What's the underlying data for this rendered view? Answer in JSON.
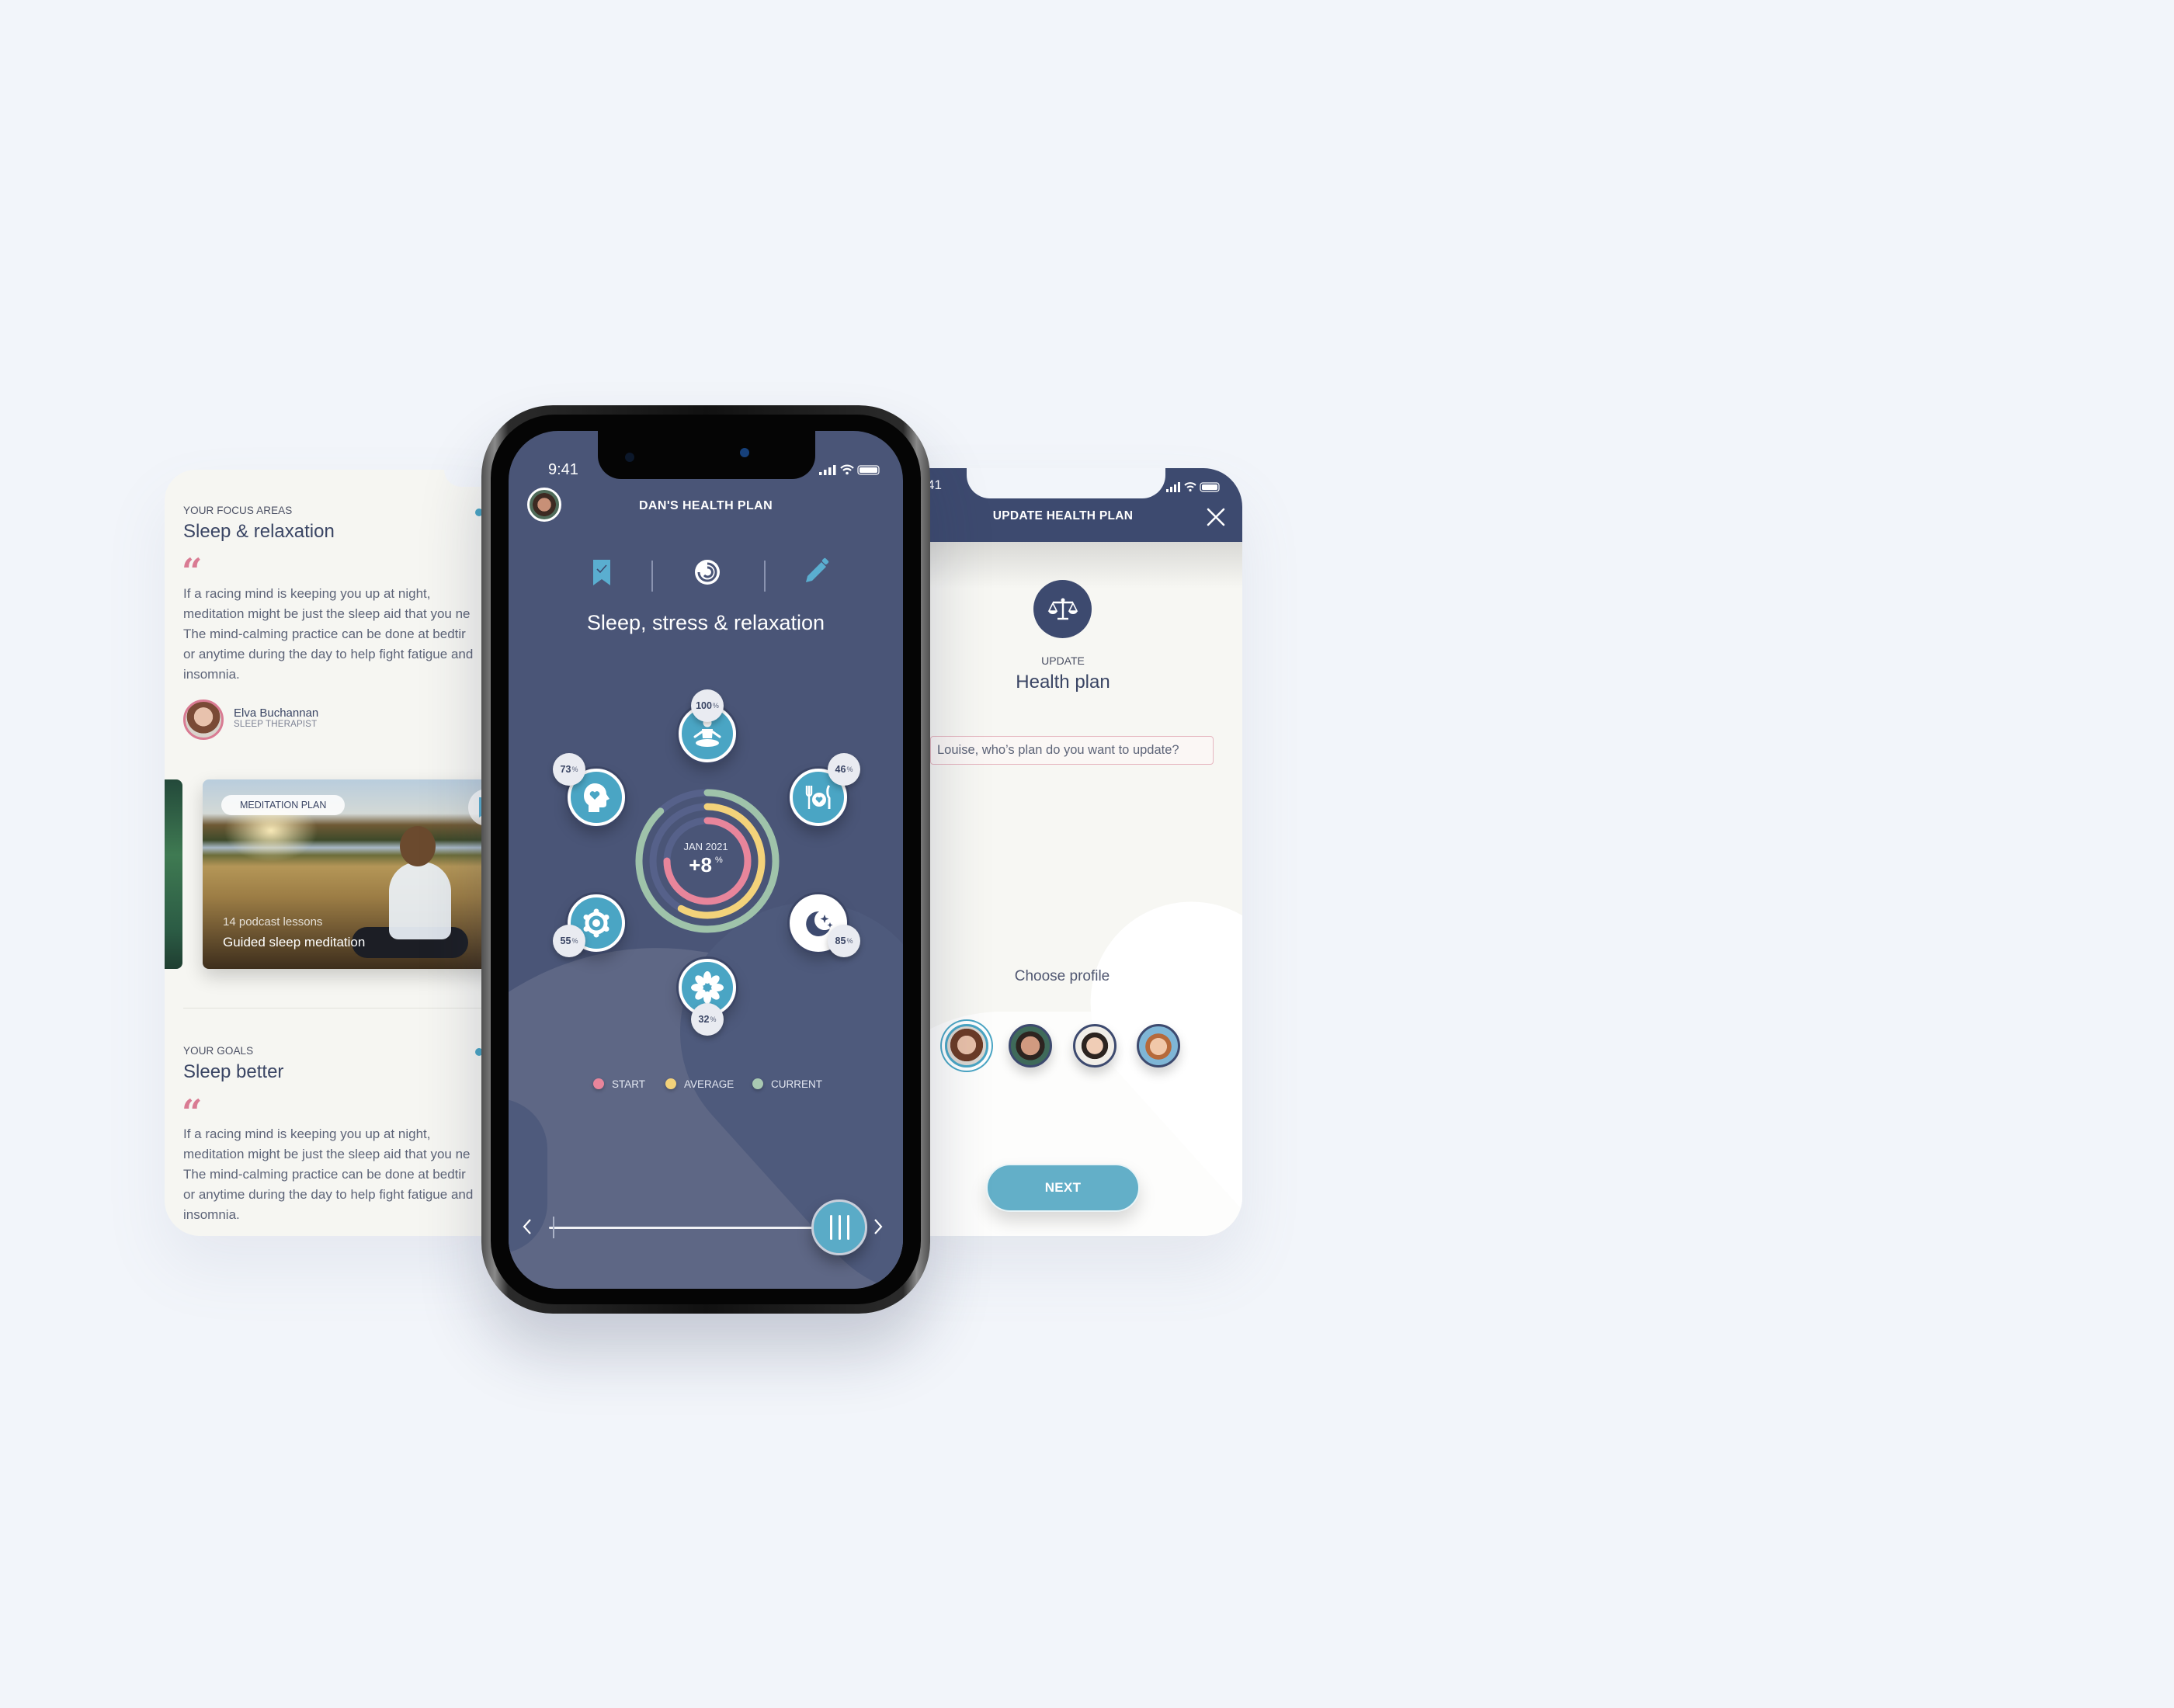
{
  "left_screen": {
    "focus": {
      "eyebrow": "YOUR FOCUS AREAS",
      "title": "Sleep & relaxation",
      "quote_mark": "“",
      "paragraph_lines": [
        "If a racing mind is keeping you up at night,",
        "meditation might be just the sleep aid that you ne",
        "The mind-calming practice can be done at bedtir",
        "or anytime during the day to help fight fatigue and",
        "insomnia."
      ],
      "therapist": {
        "name": "Elva Buchannan",
        "role": "SLEEP THERAPIST"
      }
    },
    "meditation_card": {
      "tag": "MEDITATION PLAN",
      "subtitle": "14 podcast lessons",
      "title": "Guided sleep meditation",
      "bookmark_icon": "bookmark-star-icon"
    },
    "goals": {
      "eyebrow": "YOUR GOALS",
      "title": "Sleep better",
      "quote_mark": "“",
      "paragraph_lines": [
        "If a racing mind is keeping you up at night,",
        "meditation might be just the sleep aid that you ne",
        "The mind-calming practice can be done at bedtir",
        "or anytime during the day to help fight fatigue and",
        "insomnia."
      ]
    }
  },
  "center_screen": {
    "status_time": "9:41",
    "title": "DAN'S HEALTH PLAN",
    "toolbar": [
      "bookmark-check-icon",
      "progress-spiral-icon",
      "pencil-icon"
    ],
    "heading": "Sleep, stress & relaxation",
    "ring": {
      "date": "JAN 2021",
      "value": "+8",
      "unit": "%"
    },
    "nodes": [
      {
        "icon": "meditation-icon",
        "value": "100",
        "unit": "%"
      },
      {
        "icon": "nutrition-icon",
        "value": "46",
        "unit": "%"
      },
      {
        "icon": "sleep-moon-icon",
        "value": "85",
        "unit": "%"
      },
      {
        "icon": "flower-icon",
        "value": "32",
        "unit": "%"
      },
      {
        "icon": "gear-flower-icon",
        "value": "55",
        "unit": "%"
      },
      {
        "icon": "mind-heart-icon",
        "value": "73",
        "unit": "%"
      }
    ],
    "legend": [
      {
        "label": "START",
        "color": "#e8859b"
      },
      {
        "label": "AVERAGE",
        "color": "#f3d27a"
      },
      {
        "label": "CURRENT",
        "color": "#a9c9b2"
      }
    ],
    "slider": {
      "position_fraction": 1.0,
      "prev_icon": "chevron-left-icon",
      "next_icon": "chevron-right-icon"
    }
  },
  "chart_data": {
    "type": "radial-bar",
    "title": "Sleep, stress & relaxation",
    "center_label": "JAN 2021",
    "center_value": "+8 %",
    "series": [
      {
        "name": "START",
        "fraction": 0.75,
        "color": "#e8859b"
      },
      {
        "name": "AVERAGE",
        "fraction": 0.58,
        "color": "#f3d27a"
      },
      {
        "name": "CURRENT",
        "fraction": 0.88,
        "color": "#9fc3aa"
      }
    ],
    "categories": [
      {
        "name": "meditation",
        "value": 100
      },
      {
        "name": "nutrition",
        "value": 46
      },
      {
        "name": "sleep",
        "value": 85
      },
      {
        "name": "relaxation",
        "value": 32
      },
      {
        "name": "stress",
        "value": 55
      },
      {
        "name": "mind",
        "value": 73
      }
    ],
    "legend": "bottom"
  },
  "right_screen": {
    "status_time": "41",
    "title": "UPDATE HEALTH PLAN",
    "close_icon": "close-icon",
    "icon": "scale-icon",
    "eyebrow": "UPDATE",
    "heading": "Health plan",
    "prompt": "Louise, who’s plan do you want to update?",
    "choose_label": "Choose profile",
    "profiles": [
      {
        "name": "Louise",
        "selected": true
      },
      {
        "name": "Dan",
        "selected": false
      },
      {
        "name": "Girl",
        "selected": false
      },
      {
        "name": "Boy",
        "selected": false
      }
    ],
    "next_label": "NEXT"
  },
  "colors": {
    "navy": "#3d4a6f",
    "screen_bg": "#4a5577",
    "accent_blue": "#4aa5c4",
    "pink": "#d97b93",
    "page_bg": "#f2f5fa"
  }
}
